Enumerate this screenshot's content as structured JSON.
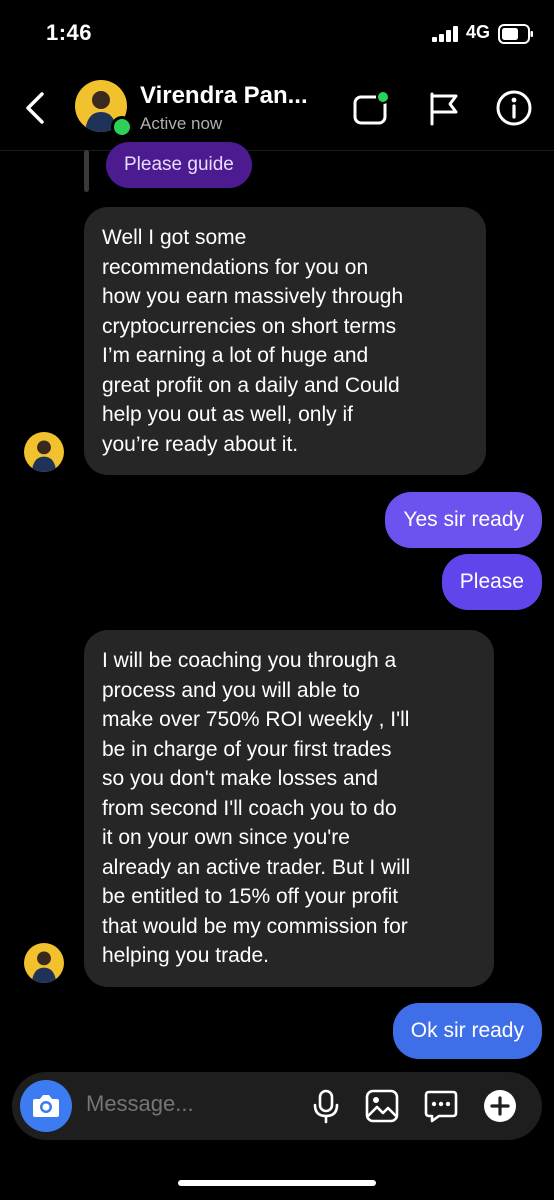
{
  "status_bar": {
    "time": "1:46",
    "network": "4G"
  },
  "header": {
    "name": "Virendra Pan...",
    "status": "Active now"
  },
  "messages": [
    {
      "type": "outgoing-quoted",
      "text": "Please guide"
    },
    {
      "type": "incoming",
      "lines": [
        "Well I got some",
        "recommendations for you on",
        "how you earn massively through",
        "cryptocurrencies on short terms",
        "I’m earning a lot of huge and",
        "great profit on a daily and Could",
        "help you out as well, only if",
        "you’re ready about it."
      ]
    },
    {
      "type": "outgoing",
      "text": "Yes sir ready"
    },
    {
      "type": "outgoing",
      "text": "Please"
    },
    {
      "type": "incoming",
      "lines": [
        "I will be coaching you through a",
        "process and you will able to",
        "make over 750% ROI weekly , I'll",
        "be in charge of your first trades",
        "so you don't make losses and",
        "from second I'll coach you to do",
        "it on your own  since you're",
        "already an active trader. But I will",
        "be entitled to 15% off your profit",
        "that would be my commission for",
        "helping you trade."
      ]
    },
    {
      "type": "outgoing",
      "text": "Ok sir ready"
    }
  ],
  "composer": {
    "placeholder": "Message..."
  },
  "icons": {
    "back": "chevron-left-icon",
    "video": "video-call-icon",
    "flag": "flag-icon",
    "info": "info-icon",
    "camera": "camera-icon",
    "mic": "microphone-icon",
    "gallery": "gallery-icon",
    "sticker": "sticker-chat-icon",
    "add": "plus-icon"
  },
  "colors": {
    "background": "#000000",
    "incoming_bubble": "#262626",
    "outgoing_top": "#7a4ef0",
    "outgoing_bottom": "#3f6fe8",
    "quoted_bubble": "#4b1b8f",
    "online": "#2ed158",
    "camera_button": "#3d7cf0"
  }
}
